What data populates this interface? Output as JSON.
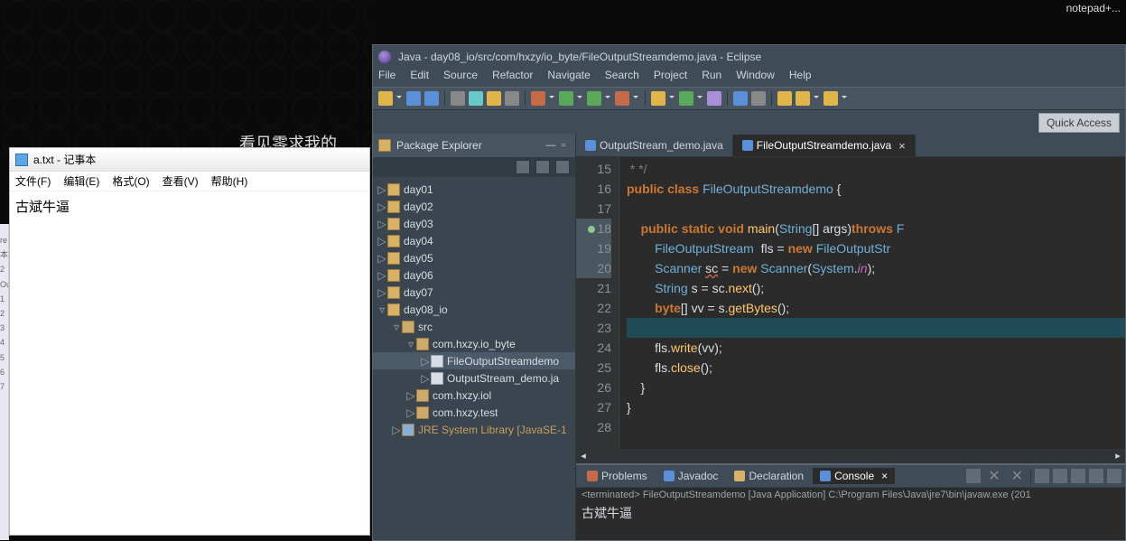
{
  "np_title_hint": "notepad+...",
  "bg_partial_text": "看见零求我的...",
  "notepad": {
    "title": "a.txt - 记事本",
    "menu": [
      "文件(F)",
      "编辑(E)",
      "格式(O)",
      "查看(V)",
      "帮助(H)"
    ],
    "content": "古斌牛逼"
  },
  "leftbar_items": [
    "re",
    "本",
    "2",
    "Ou",
    "1",
    "2",
    "3",
    "4",
    "5",
    "6",
    "7"
  ],
  "eclipse": {
    "title": "Java - day08_io/src/com/hxzy/io_byte/FileOutputStreamdemo.java - Eclipse",
    "menu": [
      "File",
      "Edit",
      "Source",
      "Refactor",
      "Navigate",
      "Search",
      "Project",
      "Run",
      "Window",
      "Help"
    ],
    "quick_access": "Quick Access"
  },
  "package_explorer": {
    "title": "Package Explorer",
    "items": [
      {
        "indent": 0,
        "arw": "▷",
        "ico": "f",
        "label": "day01"
      },
      {
        "indent": 0,
        "arw": "▷",
        "ico": "f",
        "label": "day02"
      },
      {
        "indent": 0,
        "arw": "▷",
        "ico": "f",
        "label": "day03"
      },
      {
        "indent": 0,
        "arw": "▷",
        "ico": "f",
        "label": "day04"
      },
      {
        "indent": 0,
        "arw": "▷",
        "ico": "f",
        "label": "day05"
      },
      {
        "indent": 0,
        "arw": "▷",
        "ico": "f",
        "label": "day06"
      },
      {
        "indent": 0,
        "arw": "▷",
        "ico": "f",
        "label": "day07"
      },
      {
        "indent": 0,
        "arw": "▿",
        "ico": "f",
        "label": "day08_io"
      },
      {
        "indent": 1,
        "arw": "▿",
        "ico": "pk",
        "label": "src"
      },
      {
        "indent": 2,
        "arw": "▿",
        "ico": "pk",
        "label": "com.hxzy.io_byte"
      },
      {
        "indent": 3,
        "arw": "▷",
        "ico": "jf",
        "label": "FileOutputStreamdemo",
        "sel": true
      },
      {
        "indent": 3,
        "arw": "▷",
        "ico": "jf",
        "label": "OutputStream_demo.ja"
      },
      {
        "indent": 2,
        "arw": "▷",
        "ico": "pk",
        "label": "com.hxzy.iol"
      },
      {
        "indent": 2,
        "arw": "▷",
        "ico": "pk",
        "label": "com.hxzy.test"
      },
      {
        "indent": 1,
        "arw": "▷",
        "ico": "lib",
        "label": "JRE System Library [JavaSE-1",
        "jse": true
      }
    ]
  },
  "editor_tabs": [
    {
      "label": "OutputStream_demo.java",
      "active": false
    },
    {
      "label": "FileOutputStreamdemo.java",
      "active": true
    }
  ],
  "code_lines": [
    {
      "n": 15,
      "html": " <span class='g'>* */</span>"
    },
    {
      "n": 16,
      "html": "<span class='k1'>public</span> <span class='k1'>class</span> <span class='k3'>FileOutputStreamdemo</span> {"
    },
    {
      "n": 17,
      "html": ""
    },
    {
      "n": 18,
      "html": "    <span class='k1'>public</span> <span class='k1'>static</span> <span class='k1'>void</span> <span class='m'>main</span>(<span class='k3'>String</span>[] <span class='id'>args</span>)<span class='k1'>throws</span> <span class='k3'>F</span>",
      "bp": true,
      "mrk": true
    },
    {
      "n": 19,
      "html": "        <span class='k3'>FileOutputStream</span>  <span class='id'>fls</span> = <span class='k1'>new</span> <span class='k3'>FileOutputStr</span>",
      "bp": true
    },
    {
      "n": 20,
      "html": "        <span class='k3'>Scanner</span> <span class='wr'>sc</span> = <span class='k1'>new</span> <span class='k3'>Scanner</span>(<span class='k3'>System</span>.<span class='p1'><i>in</i></span>);",
      "bp": true
    },
    {
      "n": 21,
      "html": "        <span class='k3'>String</span> <span class='id'>s</span> = <span class='id'>sc</span>.<span class='m'>next</span>();"
    },
    {
      "n": 22,
      "html": "        <span class='k1'>byte</span>[] <span class='id'>vv</span> = <span class='id'>s</span>.<span class='m'>getBytes</span>();"
    },
    {
      "n": 23,
      "html": "",
      "hl": true
    },
    {
      "n": 24,
      "html": "        <span class='id'>fls</span>.<span class='m'>write</span>(<span class='id'>vv</span>);"
    },
    {
      "n": 25,
      "html": "        <span class='id'>fls</span>.<span class='m'>close</span>();"
    },
    {
      "n": 26,
      "html": "    }"
    },
    {
      "n": 27,
      "html": "}"
    },
    {
      "n": 28,
      "html": ""
    }
  ],
  "bottom_tabs": [
    {
      "label": "Problems",
      "ico": "r"
    },
    {
      "label": "Javadoc",
      "ico": "b"
    },
    {
      "label": "Declaration",
      "ico": "y"
    },
    {
      "label": "Console",
      "ico": "b",
      "active": true
    }
  ],
  "console_status": "<terminated> FileOutputStreamdemo [Java Application] C:\\Program Files\\Java\\jre7\\bin\\javaw.exe (201",
  "console_output": "古斌牛逼"
}
